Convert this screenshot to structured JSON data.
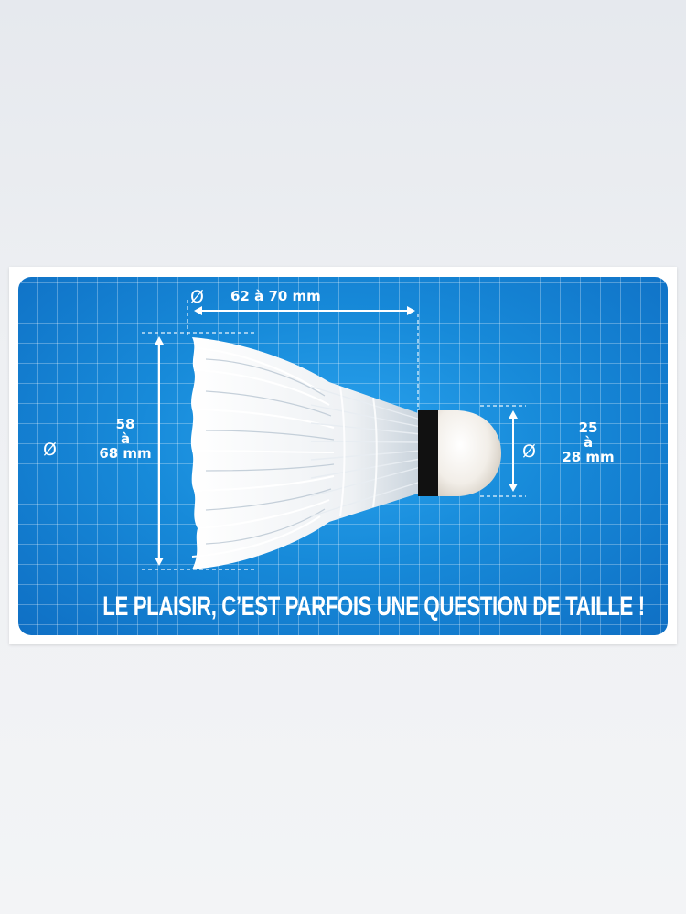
{
  "poster": {
    "length_label": "62 à 70 mm",
    "feather_diameter": {
      "symbol": "Ø",
      "line1": "58",
      "line2": "à",
      "line3": "68 mm"
    },
    "base_diameter": {
      "symbol": "Ø",
      "line1": "25",
      "line2": "à",
      "line3": "28 mm"
    },
    "length_symbol": "Ø",
    "tagline": "LE PLAISIR, C’EST PARFOIS UNE QUESTION DE TAILLE  !"
  },
  "colors": {
    "background_blue": "#178ad9",
    "grid_line": "#ffffff",
    "text": "#ffffff",
    "band": "#111111",
    "feather": "#f4f4f4"
  },
  "icons": [
    "shuttlecock-illustration",
    "dimension-arrow",
    "diameter-symbol"
  ]
}
